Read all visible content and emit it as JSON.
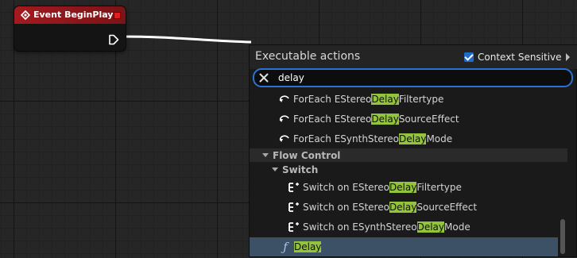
{
  "graph": {
    "event_node": {
      "title": "Event BeginPlay"
    }
  },
  "menu": {
    "title": "Executable actions",
    "context_sensitive": {
      "label": "Context Sensitive",
      "checked": true
    },
    "search": {
      "value": "delay"
    },
    "rows_top": [
      {
        "pre": "ForEach EStereo",
        "hl": "Delay",
        "post": "Filtertype",
        "icon": "foreach-loop-icon"
      },
      {
        "pre": "ForEach EStereo",
        "hl": "Delay",
        "post": "SourceEffect",
        "icon": "foreach-loop-icon"
      },
      {
        "pre": "ForEach ESynthStereo",
        "hl": "Delay",
        "post": "Mode",
        "icon": "foreach-loop-icon"
      }
    ],
    "category_flow": "Flow Control",
    "subcategory_switch": "Switch",
    "rows_switch": [
      {
        "pre": "Switch on EStereo",
        "hl": "Delay",
        "post": "Filtertype",
        "icon": "switch-node-icon"
      },
      {
        "pre": "Switch on EStereo",
        "hl": "Delay",
        "post": "SourceEffect",
        "icon": "switch-node-icon"
      },
      {
        "pre": "Switch on ESynthStereo",
        "hl": "Delay",
        "post": "Mode",
        "icon": "switch-node-icon"
      }
    ],
    "selected_row": {
      "icon_glyph": "ƒ",
      "hl": "Delay",
      "icon": "function-icon"
    }
  },
  "colors": {
    "event_header": "#a21a1f",
    "search_focus": "#2a72d4",
    "match_highlight": "#94c43c",
    "selection": "#3c5066",
    "context_checkbox": "#1d6ad0"
  }
}
